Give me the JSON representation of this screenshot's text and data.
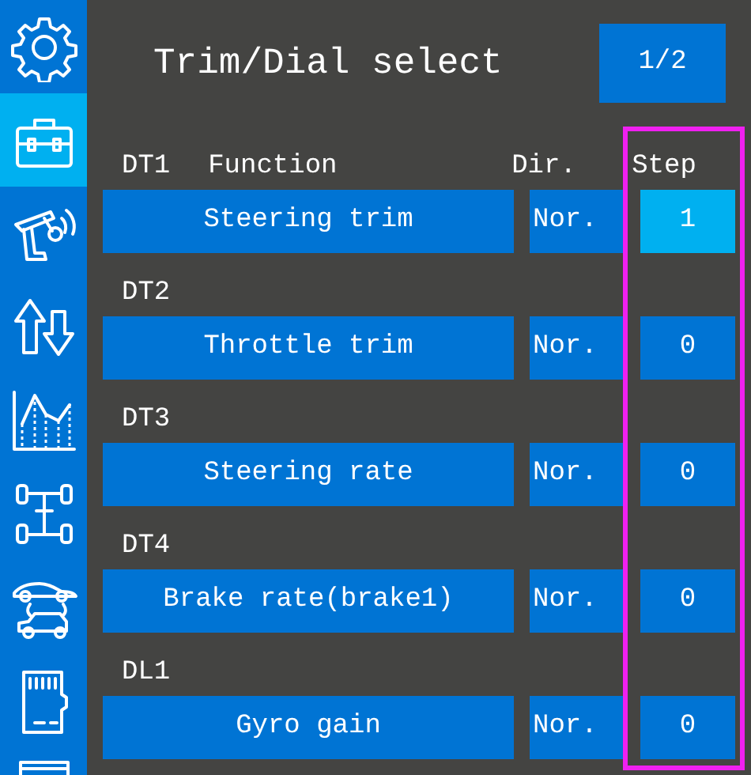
{
  "sidebar": {
    "items": [
      {
        "selected": false
      },
      {
        "selected": true
      },
      {
        "selected": false
      },
      {
        "selected": false
      },
      {
        "selected": false
      },
      {
        "selected": false
      },
      {
        "selected": false
      },
      {
        "selected": false
      },
      {
        "selected": false
      }
    ]
  },
  "header": {
    "title": "Trim/Dial select",
    "page_button": "1/2"
  },
  "columns": {
    "function": "Function",
    "direction": "Dir.",
    "step": "Step"
  },
  "step_column_highlighted": true,
  "rows": [
    {
      "channel": "DT1",
      "function": "Steering trim",
      "direction": "Nor.",
      "step": "1",
      "selected": true
    },
    {
      "channel": "DT2",
      "function": "Throttle trim",
      "direction": "Nor.",
      "step": "0",
      "selected": false
    },
    {
      "channel": "DT3",
      "function": "Steering rate",
      "direction": "Nor.",
      "step": "0",
      "selected": false
    },
    {
      "channel": "DT4",
      "function": "Brake rate(brake1)",
      "direction": "Nor.",
      "step": "0",
      "selected": false
    },
    {
      "channel": "DL1",
      "function": "Gyro gain",
      "direction": "Nor.",
      "step": "0",
      "selected": false
    }
  ]
}
